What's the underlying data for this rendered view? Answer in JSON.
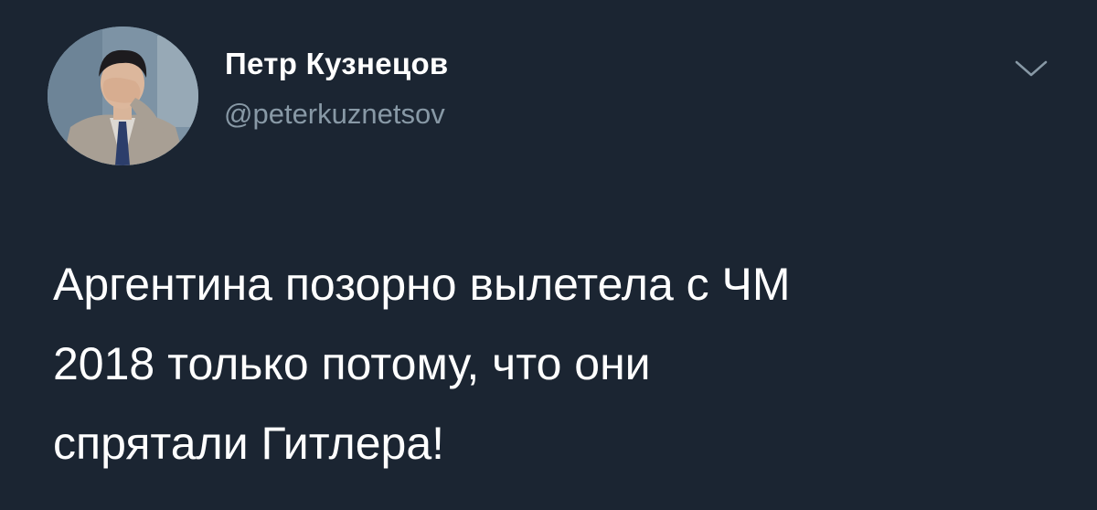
{
  "tweet": {
    "author": {
      "display_name": "Петр Кузнецов",
      "handle": "@peterkuznetsov",
      "avatar": "avatar-photo-man-facepalm"
    },
    "menu_icon": "chevron-down-icon",
    "text_lines": [
      "Аргентина позорно вылетела с ЧМ",
      "2018 только потому, что они",
      "спрятали Гитлера!"
    ]
  },
  "colors": {
    "background": "#1b2532",
    "name": "#ffffff",
    "handle": "#8899a6",
    "text": "#ffffff",
    "icon": "#8899a6"
  }
}
